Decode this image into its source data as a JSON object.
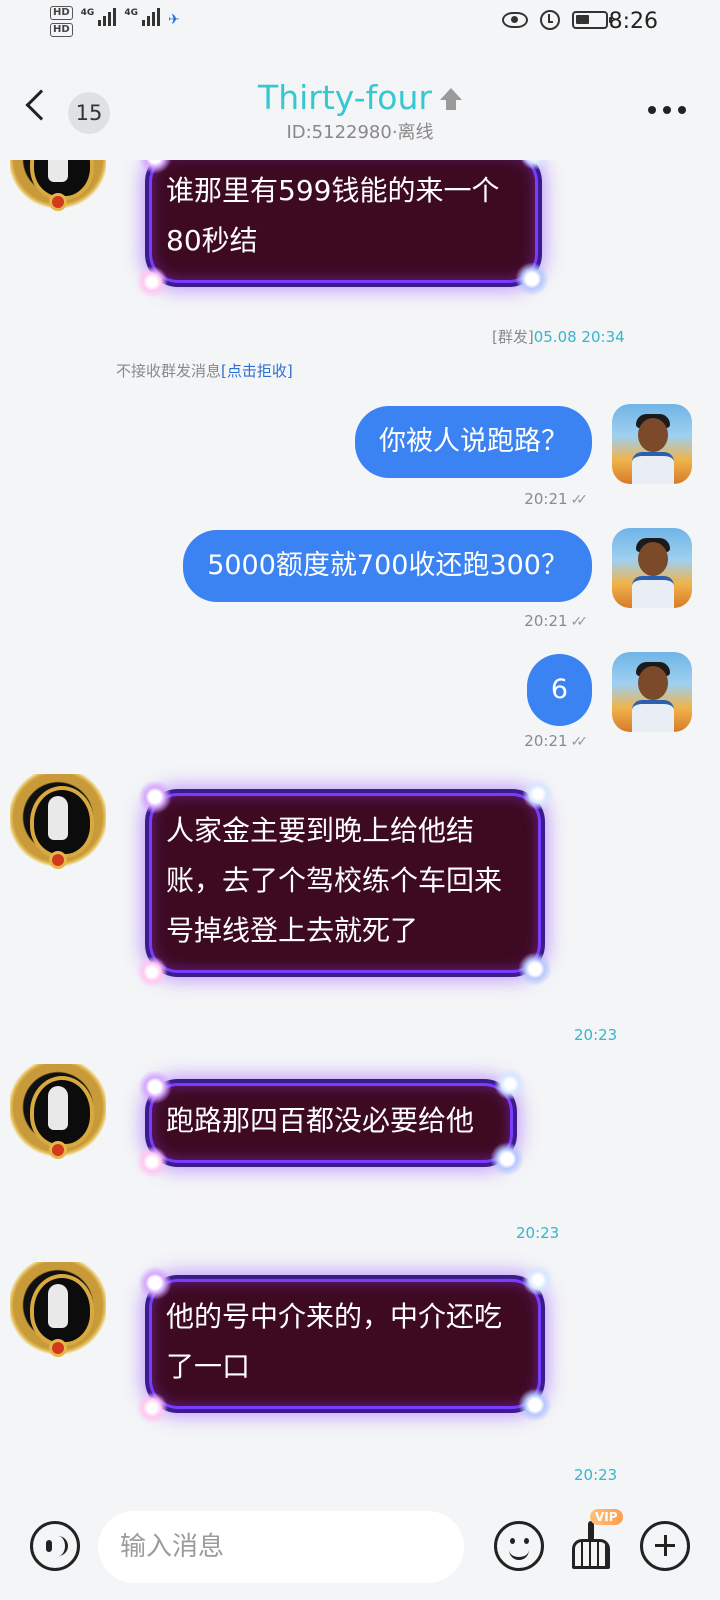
{
  "status_bar": {
    "hd1": "HD",
    "hd2": "HD",
    "net1": "4G",
    "net2": "4G",
    "time": "8:26"
  },
  "header": {
    "unread_count": "15",
    "title": "Thirty-four",
    "subtitle": "ID:5122980·离线"
  },
  "messages": {
    "m1": {
      "lines": [
        "谁那里有599钱能的来一个",
        "80秒结"
      ],
      "tag": "[群发]",
      "time": "05.08 20:34"
    },
    "notice": {
      "text": "不接收群发消息",
      "link": "[点击拒收]"
    },
    "m2": {
      "text": "你被人说跑路？",
      "time": "20:21"
    },
    "m3": {
      "text": "5000额度就700收还跑300？",
      "time": "20:21"
    },
    "m4": {
      "text": "6",
      "time": "20:21"
    },
    "m5": {
      "lines": [
        "人家金主要到晚上给他结",
        "账，去了个驾校练个车回来",
        "号掉线登上去就死了"
      ],
      "time": "20:23"
    },
    "m6": {
      "lines": [
        "跑路那四百都没必要给他"
      ],
      "time": "20:23"
    },
    "m7": {
      "lines": [
        "他的号中介来的，中介还吃",
        "了一口"
      ],
      "time": "20:23"
    }
  },
  "input_bar": {
    "placeholder": "输入消息",
    "vip_label": "VIP"
  },
  "colors": {
    "accent_cyan": "#36c7d0",
    "outgoing_bubble": "#3b82f3",
    "incoming_bubble": "#3d0a22"
  }
}
